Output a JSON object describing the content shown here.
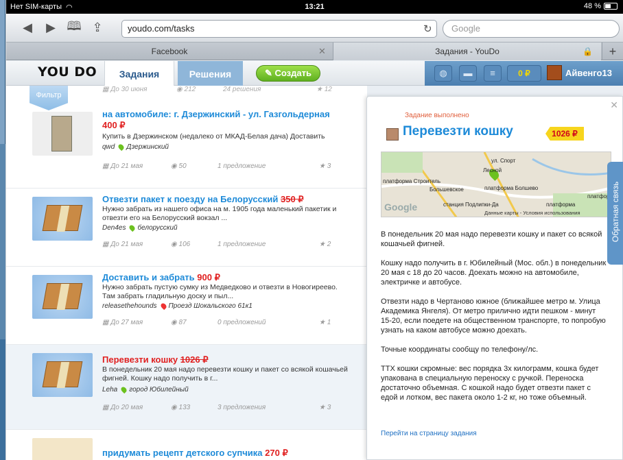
{
  "status_bar": {
    "carrier": "Нет SIM-карты",
    "time": "13:21",
    "battery": "48 %"
  },
  "browser": {
    "url": "youdo.com/tasks",
    "search_placeholder": "Google",
    "tabs": [
      {
        "label": "Facebook"
      },
      {
        "label": "Задания - YouDo"
      }
    ]
  },
  "site": {
    "logo": "YOU DO",
    "nav": [
      {
        "label": "Задания"
      },
      {
        "label": "Решения"
      }
    ],
    "create_label": "Создать",
    "balance": "0 ₽",
    "username": "Айвенго13"
  },
  "list": {
    "filter_label": "Фильтр",
    "top_row": {
      "deadline": "До 30 июня",
      "views": "212",
      "offers": "24 решения",
      "stars": "12"
    },
    "items": [
      {
        "title": "на автомобиле: г. Дзержинский - ул. Газгольдерная",
        "price": "400 ₽",
        "desc": "Купить в Дзержинском (недалеко от МКАД-Белая дача)  Доставить",
        "user": "qwd",
        "location": "Дзержинский",
        "deadline": "До 21 мая",
        "views": "50",
        "offers": "1 предложение",
        "stars": "3"
      },
      {
        "title": "Отвезти пакет к поезду на Белорусский",
        "price": "350 ₽",
        "desc": "Нужно забрать из нашего офиса на м. 1905 года маленький пакетик и отвезти его на Белорусский вокзал ...",
        "user": "Den4es",
        "location": "белорусский",
        "deadline": "До 21 мая",
        "views": "106",
        "offers": "1 предложение",
        "stars": "2"
      },
      {
        "title": "Доставить и забрать",
        "price": "900 ₽",
        "desc": "Нужно забрать пустую сумку из Медведково и отвезти в Новогиреево. Там забрать гладильную доску и пыл...",
        "user": "releasethehounds",
        "location": "Проезд Шокальского 61к1",
        "deadline": "До 27 мая",
        "views": "87",
        "offers": "0 предложений",
        "stars": "1"
      },
      {
        "title": "Перевезти кошку",
        "price": "1026 ₽",
        "desc": "В понедельник 20 мая надо перевезти кошку и пакет со всякой кошачьей фигней. Кошку надо получить в г...",
        "user": "Leha",
        "location": "город Юбилейный",
        "deadline": "До 20 мая",
        "views": "133",
        "offers": "3 предложения",
        "stars": "3"
      },
      {
        "title": "придумать рецепт детского супчика",
        "price": "270 ₽"
      }
    ]
  },
  "detail": {
    "status": "Задание выполнено",
    "title": "Перевезти кошку",
    "price": "1026 ₽",
    "map": {
      "labels": [
        "платформа Строитель",
        "Большевское",
        "платформа Болшево",
        "платформа Загоря",
        "Лесной",
        "ул. Спорт",
        "станция Подлипки-Да",
        "платформа",
        "Google"
      ],
      "copyright": "Данные карты - Условия использования"
    },
    "paragraphs": [
      "В понедельник 20 мая надо перевезти кошку и пакет со всякой кошачьей фигней.",
      "Кошку надо получить в г. Юбилейный (Мос. обл.) в понедельник 20 мая с 18 до 20 часов. Доехать можно на автомобиле, электричке и автобусе.",
      "Отвезти надо в Чертаново южное (ближайшее метро м. Улица Академика Янгеля). От метро прилично идти пешком - минут 15-20, если поедете на общественном транспорте, то попробую узнать на каком автобусе можно доехать.",
      "Точные координаты сообщу по телефону/лс.",
      "ТТХ кошки скромные: вес порядка 3х килограмм, кошка будет упакована в специальную переноску с ручкой. Переноска достаточно объемная. С кошкой надо будет отвезти пакет с едой и лотком, вес пакета около 1-2 кг, но тоже объемный."
    ],
    "link": "Перейти на страницу задания"
  },
  "feedback": "Обратная связь"
}
